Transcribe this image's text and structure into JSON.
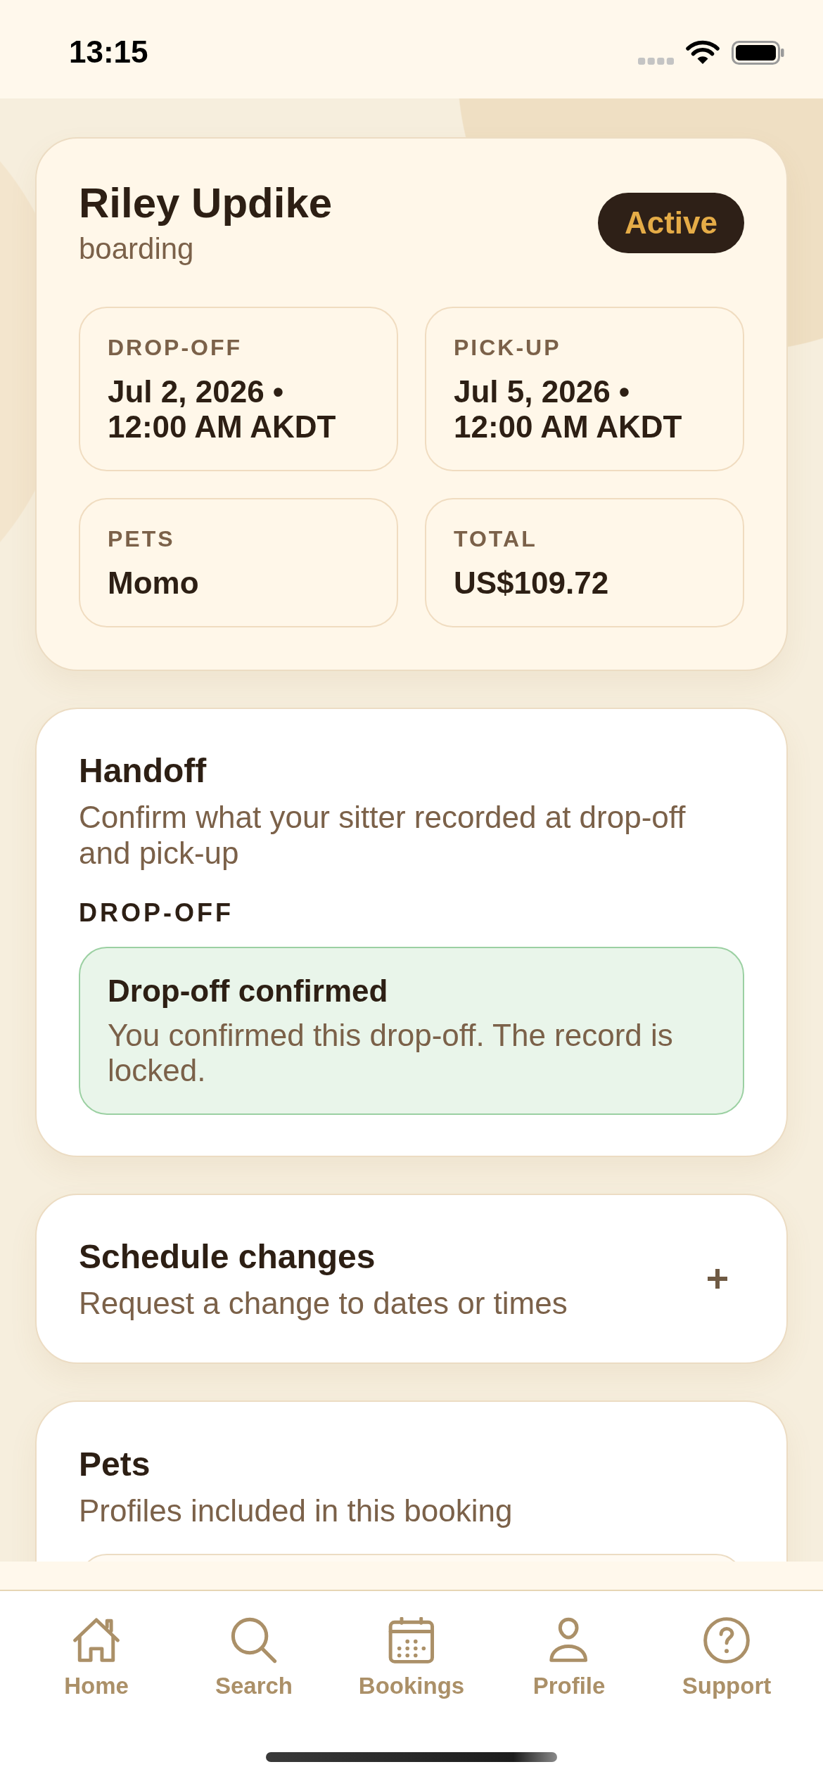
{
  "status_bar": {
    "time": "13:15"
  },
  "booking": {
    "name": "Riley Updike",
    "service": "boarding",
    "status": "Active",
    "details": [
      {
        "label": "DROP-OFF",
        "value": "Jul 2, 2026 • 12:00 AM AKDT"
      },
      {
        "label": "PICK-UP",
        "value": "Jul 5, 2026 • 12:00 AM AKDT"
      },
      {
        "label": "PETS",
        "value": "Momo"
      },
      {
        "label": "TOTAL",
        "value": "US$109.72"
      }
    ]
  },
  "handoff": {
    "title": "Handoff",
    "subtitle": "Confirm what your sitter recorded at drop-off and pick-up",
    "section_label": "DROP-OFF",
    "notice": {
      "title": "Drop-off confirmed",
      "message": "You confirmed this drop-off. The record is locked."
    }
  },
  "schedule_changes": {
    "title": "Schedule changes",
    "subtitle": "Request a change to dates or times",
    "expanded": false
  },
  "pets": {
    "title": "Pets",
    "subtitle": "Profiles included in this booking"
  },
  "tab_bar": [
    {
      "label": "Home",
      "selected": false
    },
    {
      "label": "Search",
      "selected": false
    },
    {
      "label": "Bookings",
      "selected": false
    },
    {
      "label": "Profile",
      "selected": false
    },
    {
      "label": "Support",
      "selected": false
    }
  ]
}
